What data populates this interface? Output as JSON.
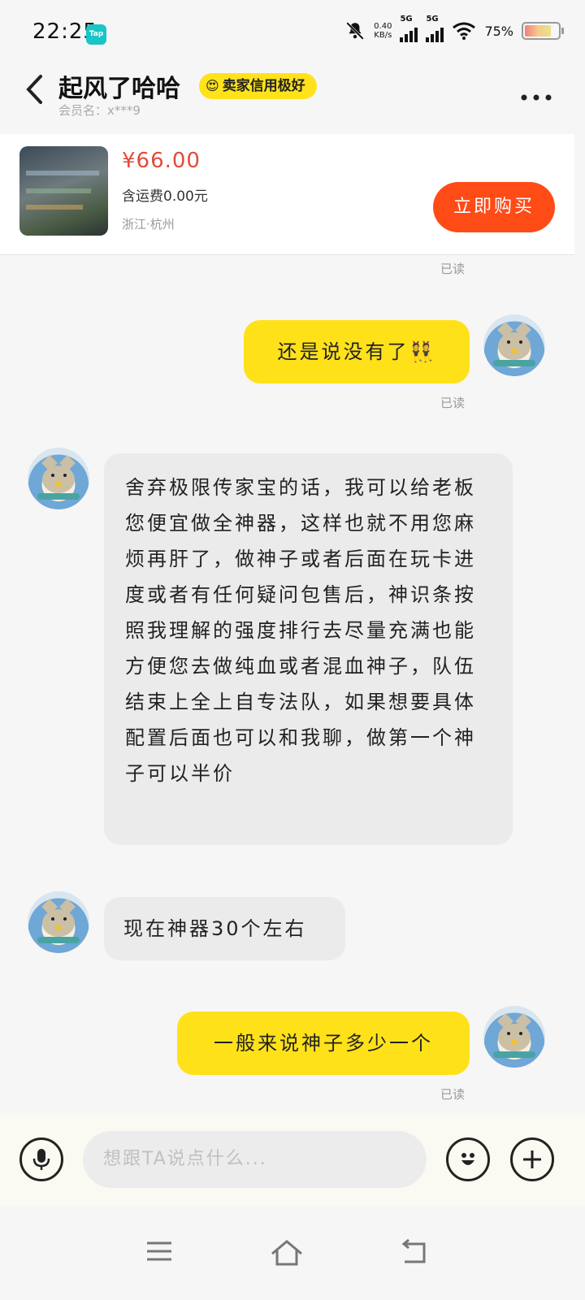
{
  "status_bar": {
    "time": "22:25",
    "app_badge": "Tap",
    "net_speed_value": "0.40",
    "net_speed_unit": "KB/s",
    "signal1_label": "5G",
    "signal2_label": "5G",
    "battery": "75%"
  },
  "header": {
    "contact_name": "起风了哈哈",
    "badge_emoji": "😍",
    "credit_badge": "卖家信用极好",
    "member_name": "会员名：x***9"
  },
  "product": {
    "price": "¥66.00",
    "shipping": "含运费0.00元",
    "location": "浙江·杭州",
    "buy_button": "立即购买"
  },
  "chat": {
    "read_label_top": "已读",
    "msg1_text": "还是说没有了",
    "msg1_emoji": "👯",
    "read_label_1": "已读",
    "msg2_text": "舍弃极限传家宝的话，我可以给老板您便宜做全神器，这样也就不用您麻烦再肝了，做神子或者后面在玩卡进度或者有任何疑问包售后，神识条按照我理解的强度排行去尽量充满也能方便您去做纯血或者混血神子，队伍结束上全上自专法队，如果想要具体配置后面也可以和我聊，做第一个神子可以半价",
    "msg3_text": "现在神器30个左右",
    "msg4_text": "一般来说神子多少一个",
    "read_label_2": "已读"
  },
  "input": {
    "placeholder": "想跟TA说点什么..."
  }
}
